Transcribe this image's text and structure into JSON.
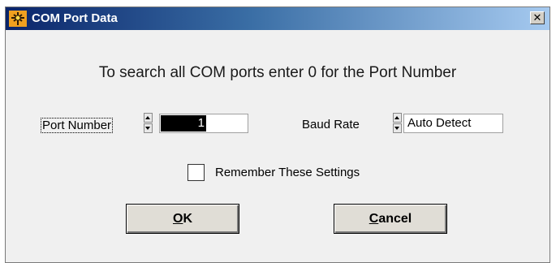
{
  "window": {
    "title": "COM Port Data",
    "close_label": "✕"
  },
  "instruction": "To search all COM ports enter 0 for the Port Number",
  "port": {
    "label": "Port Number",
    "value": "1"
  },
  "baud": {
    "label": "Baud Rate",
    "value": "Auto Detect"
  },
  "remember": {
    "label": "Remember These Settings",
    "checked": false
  },
  "buttons": {
    "ok_mnemonic": "O",
    "ok_rest": "K",
    "cancel_mnemonic": "C",
    "cancel_rest": "ancel"
  },
  "colors": {
    "titlebar_start": "#0a246a",
    "titlebar_end": "#a6caf0",
    "dialog_bg": "#f0f0f0"
  },
  "icons": {
    "app_icon": "antenna-icon"
  }
}
